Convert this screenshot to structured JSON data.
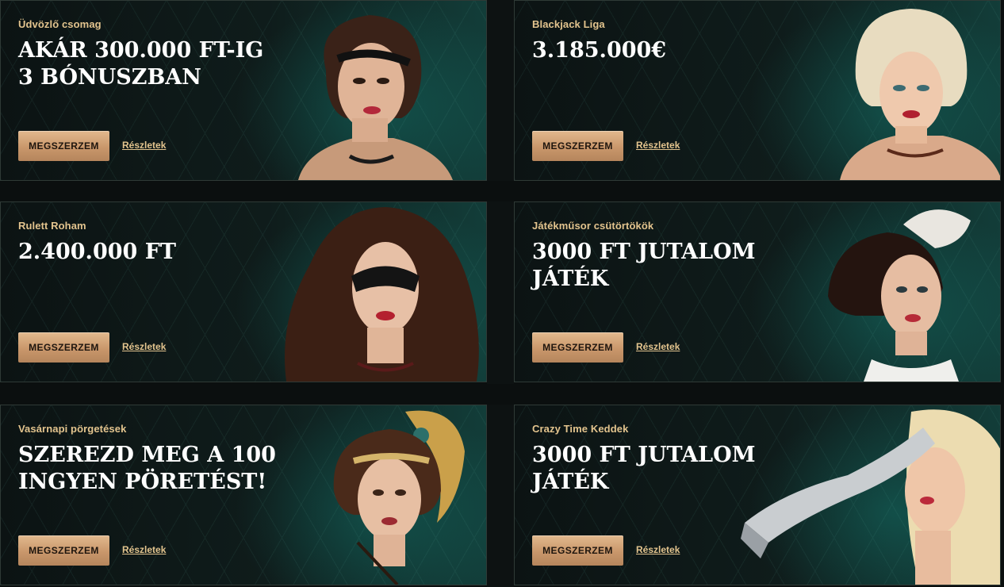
{
  "promos": [
    {
      "label": "Üdvözlő csomag",
      "title_line1": "AKÁR 300.000 FT-IG",
      "title_line2": "3 BÓNUSZBAN",
      "button": "MEGSZERZEM",
      "link": "Részletek"
    },
    {
      "label": "Blackjack Liga",
      "title_line1": "3.185.000€",
      "title_line2": "",
      "button": "MEGSZERZEM",
      "link": "Részletek"
    },
    {
      "label": "Rulett Roham",
      "title_line1": "2.400.000 FT",
      "title_line2": "",
      "button": "MEGSZERZEM",
      "link": "Részletek"
    },
    {
      "label": "Játékműsor csütörtökök",
      "title_line1": "3000 FT JUTALOM",
      "title_line2": "JÁTÉK",
      "button": "MEGSZERZEM",
      "link": "Részletek"
    },
    {
      "label": "Vasárnapi pörgetések",
      "title_line1": "SZEREZD MEG A 100",
      "title_line2": "INGYEN PÖRETÉST!",
      "button": "MEGSZERZEM",
      "link": "Részletek"
    },
    {
      "label": "Crazy Time Keddek",
      "title_line1": "3000 FT JUTALOM",
      "title_line2": "JÁTÉK",
      "button": "MEGSZERZEM",
      "link": "Részletek"
    }
  ],
  "colors": {
    "accent_gold": "#e3c48e",
    "button_gold": "#c9976b",
    "background": "#0b0f0f",
    "teal_glow": "#123d39"
  }
}
